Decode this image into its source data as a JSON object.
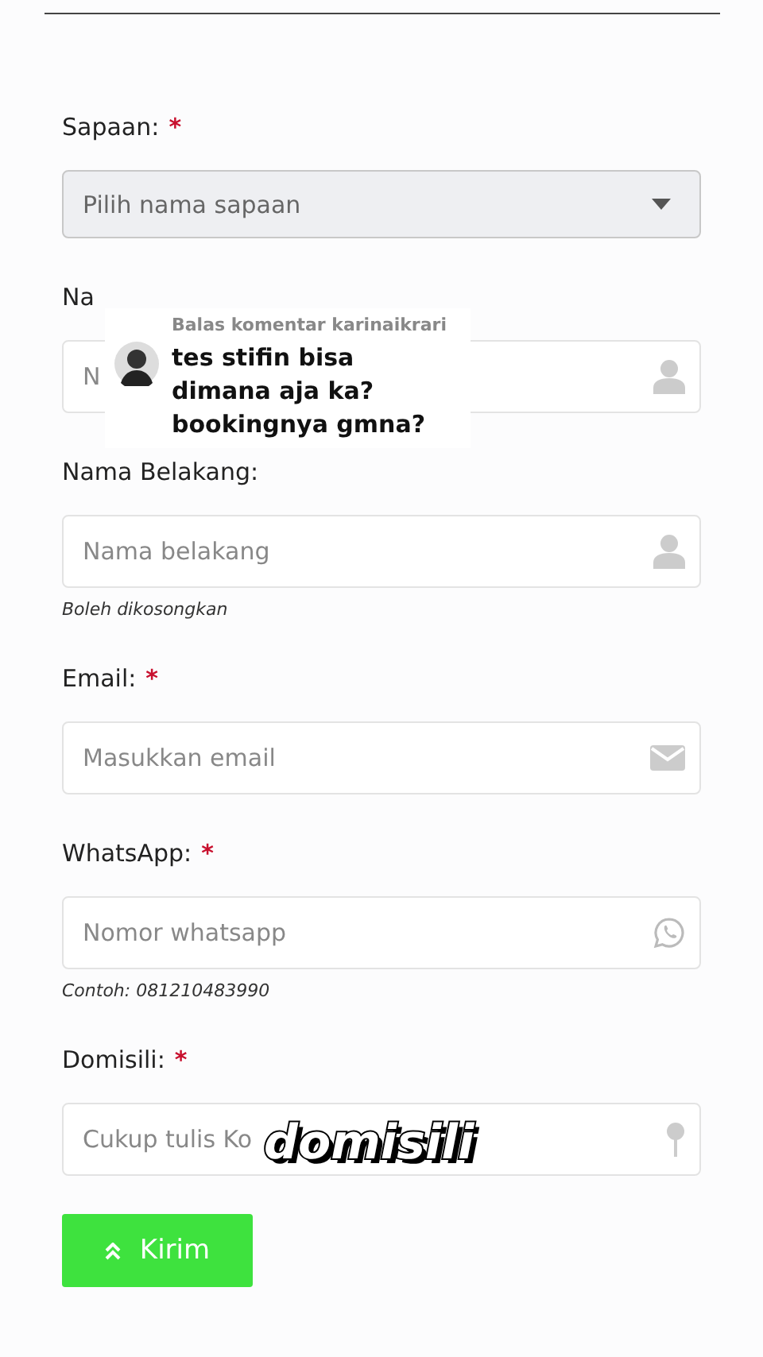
{
  "fields": [
    {
      "kind": "select",
      "label": "Sapaan:",
      "required_mark": "*",
      "placeholder": "Pilih nama sapaan"
    },
    {
      "kind": "input",
      "label": "Na",
      "placeholder": "N"
    },
    {
      "kind": "input",
      "label": "Nama Belakang:",
      "placeholder": "Nama belakang",
      "hint": "Boleh dikosongkan"
    },
    {
      "kind": "input",
      "label": "Email:",
      "required_mark": "*",
      "placeholder": "Masukkan email"
    },
    {
      "kind": "input",
      "label": "WhatsApp:",
      "required_mark": "*",
      "placeholder": "Nomor whatsapp",
      "hint": "Contoh: 081210483990"
    },
    {
      "kind": "input",
      "label": "Domisili:",
      "required_mark": "*",
      "placeholder": "Cukup tulis Ko"
    }
  ],
  "submit": {
    "label": "Kirim"
  },
  "comment": {
    "header": "Balas komentar karinaikrari",
    "text": "tes stifin bisa dimana aja ka? bookingnya gmna?"
  },
  "caption": "domisili"
}
